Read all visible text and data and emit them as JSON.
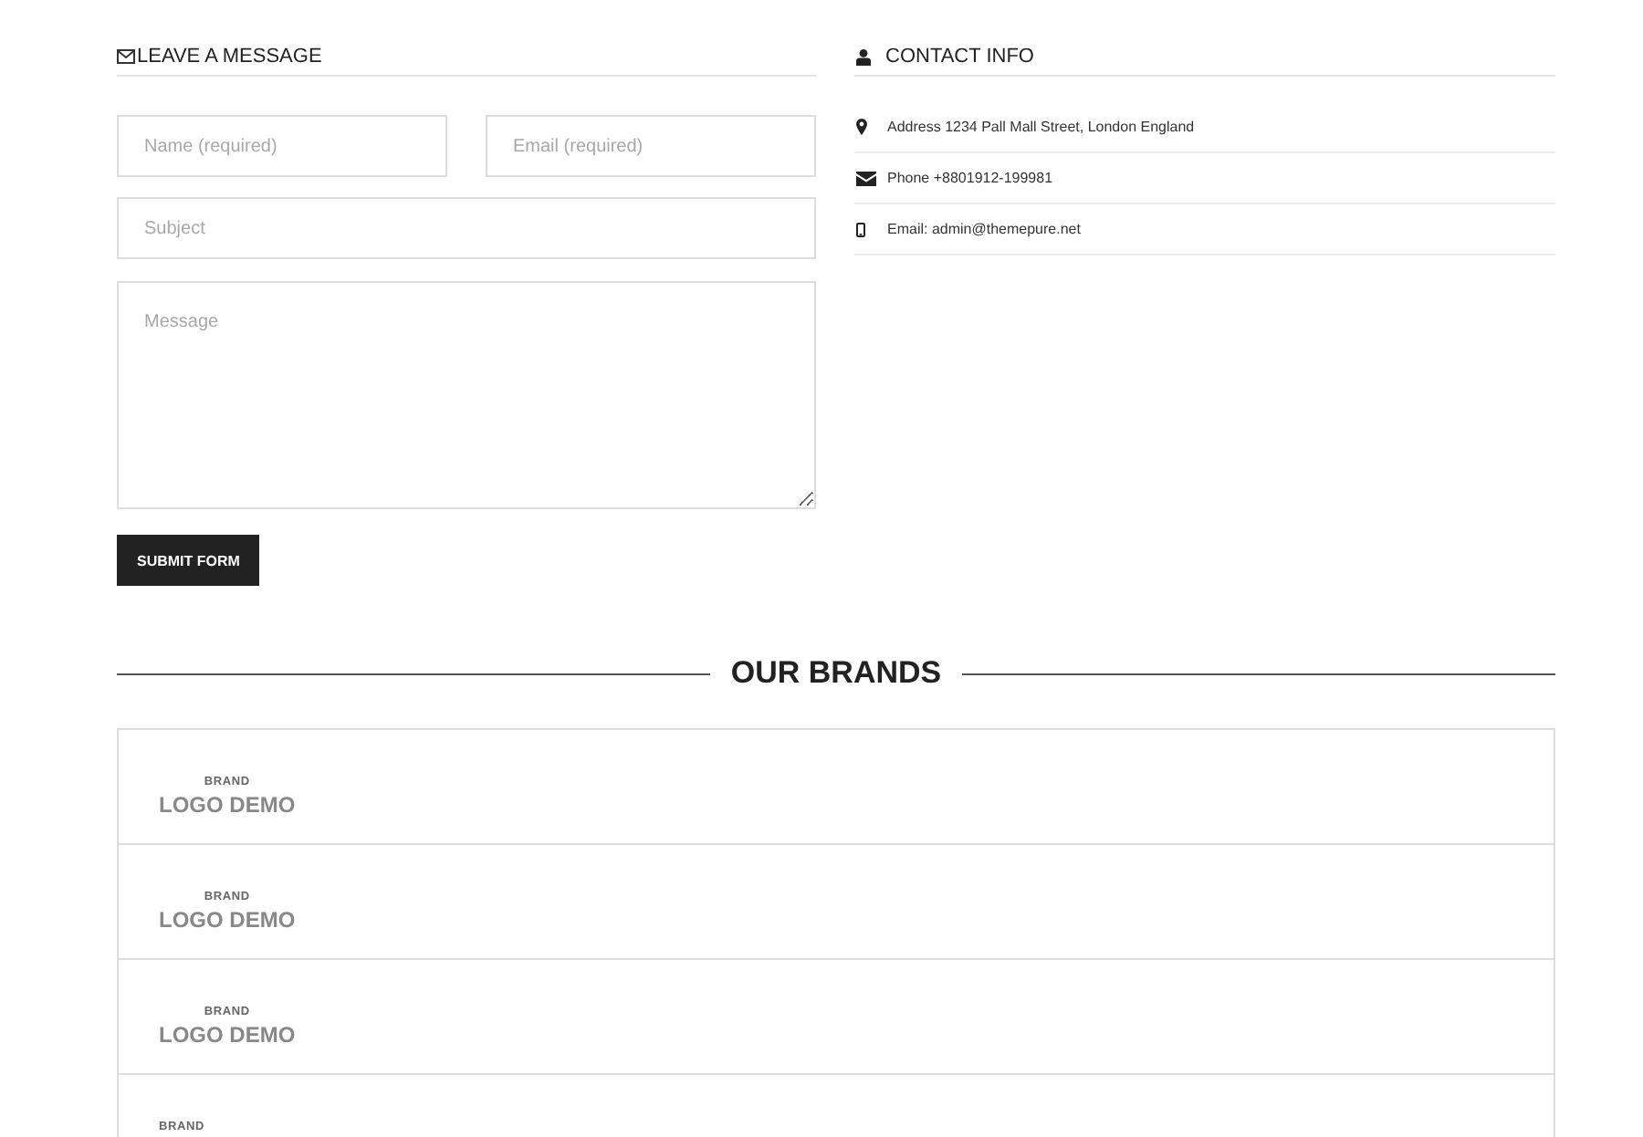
{
  "contact_form": {
    "heading": "LEAVE A MESSAGE",
    "rows": [
      [
        {
          "kind": "input",
          "placeholder": "Name (required)"
        },
        {
          "kind": "input",
          "placeholder": "Email (required)"
        }
      ],
      [
        {
          "kind": "input",
          "placeholder": "Subject"
        }
      ],
      [
        {
          "kind": "textarea",
          "placeholder": "Message"
        }
      ]
    ],
    "submit_button": "SUBMIT FORM"
  },
  "contact_info": {
    "heading": "CONTACT INFO",
    "items": [
      {
        "kind": "address",
        "text": "Address 1234 Pall Mall Street, London England"
      },
      {
        "kind": "phone",
        "text": "Phone +8801912-199981"
      },
      {
        "kind": "email",
        "text": "Email: admin@themepure.net"
      }
    ]
  },
  "brands": {
    "heading": "OUR BRANDS",
    "items": [
      {
        "label": "BRAND",
        "name": "LOGO DEMO"
      },
      {
        "label": "BRAND",
        "name": "LOGO DEMO"
      },
      {
        "label": "BRAND",
        "name": "LOGO DEMO"
      },
      {
        "label": "BRAND"
      }
    ]
  }
}
